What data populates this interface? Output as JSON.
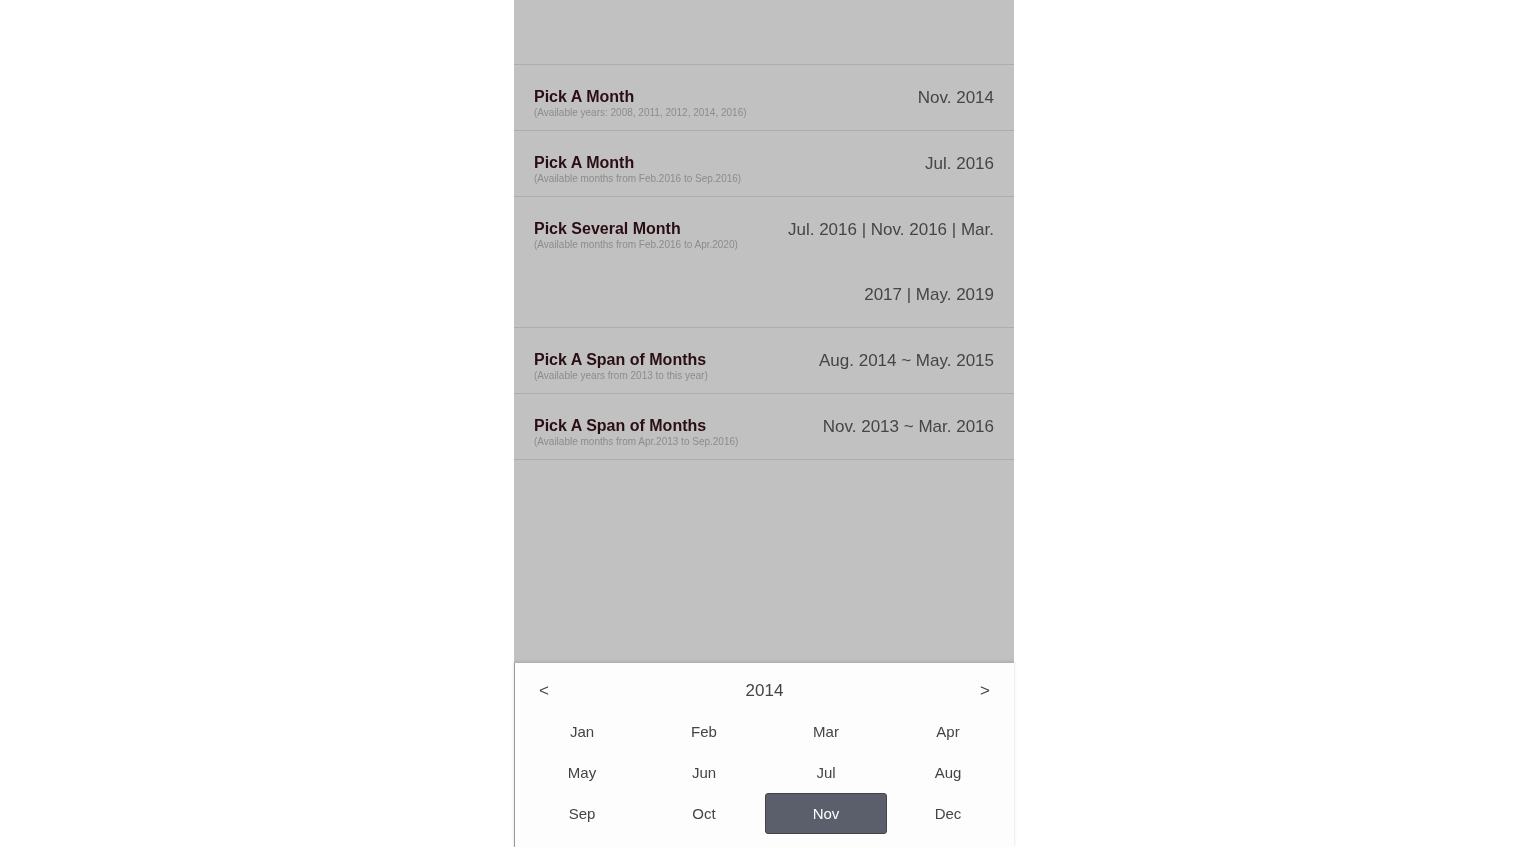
{
  "rows": [
    {
      "title": "Pick A Month",
      "subtitle": "(Available years: 2008, 2011, 2012, 2014, 2016)",
      "value": "Nov. 2014"
    },
    {
      "title": "Pick A Month",
      "subtitle": "(Available months from Feb.2016 to Sep.2016)",
      "value": "Jul. 2016"
    },
    {
      "title": "Pick Several Month",
      "subtitle": "(Available months from Feb.2016 to Apr.2020)",
      "value": "Jul. 2016 | Nov. 2016 | Mar. 2017 | May. 2019"
    },
    {
      "title": "Pick A Span of Months",
      "subtitle": "(Available years from 2013 to this year)",
      "value": "Aug. 2014 ~ May. 2015"
    },
    {
      "title": "Pick A Span of Months",
      "subtitle": "(Available months from Apr.2013 to Sep.2016)",
      "value": "Nov. 2013 ~ Mar. 2016"
    }
  ],
  "picker": {
    "prev": "<",
    "year": "2014",
    "next": ">",
    "months": [
      {
        "label": "Jan",
        "selected": false
      },
      {
        "label": "Feb",
        "selected": false
      },
      {
        "label": "Mar",
        "selected": false
      },
      {
        "label": "Apr",
        "selected": false
      },
      {
        "label": "May",
        "selected": false
      },
      {
        "label": "Jun",
        "selected": false
      },
      {
        "label": "Jul",
        "selected": false
      },
      {
        "label": "Aug",
        "selected": false
      },
      {
        "label": "Sep",
        "selected": false
      },
      {
        "label": "Oct",
        "selected": false
      },
      {
        "label": "Nov",
        "selected": true
      },
      {
        "label": "Dec",
        "selected": false
      }
    ]
  }
}
